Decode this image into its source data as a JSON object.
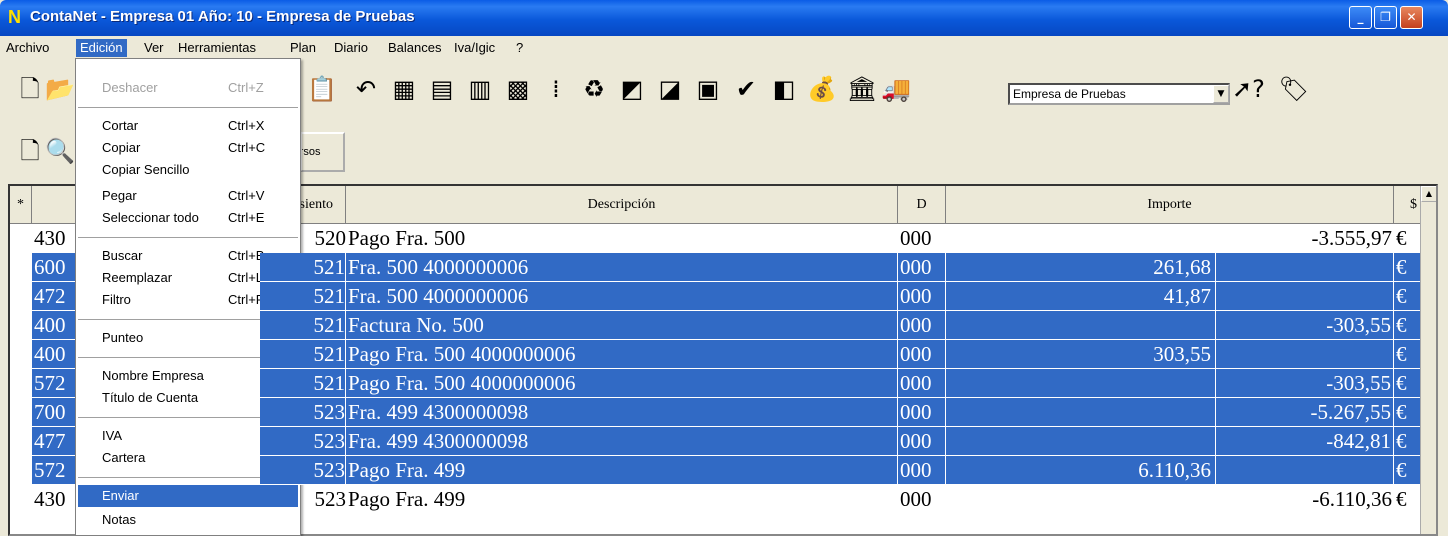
{
  "window": {
    "title": "ContaNet - Empresa 01  Año: 10 - Empresa de Pruebas"
  },
  "menubar": [
    "Archivo",
    "Edición",
    "Ver",
    "Herramientas",
    "Plan",
    "Diario",
    "Balances",
    "Iva/Igic",
    "?"
  ],
  "toolbar": {
    "company_value": "Empresa de Pruebas",
    "recursos_label": "Recursos"
  },
  "grid": {
    "headers": {
      "star": "*",
      "asiento": "Asiento",
      "descripcion": "Descripción",
      "d": "D",
      "importe": "Importe",
      "currency": "$"
    },
    "rows": [
      {
        "account": "430",
        "asiento": "520",
        "desc": "Pago Fra. 500",
        "d": "000",
        "debe": "",
        "haber": "-3.555,97",
        "cur": "€",
        "selected": false
      },
      {
        "account": "600",
        "asiento": "521",
        "desc": "Fra. 500 4000000006",
        "d": "000",
        "debe": "261,68",
        "haber": "",
        "cur": "€",
        "selected": true
      },
      {
        "account": "472",
        "asiento": "521",
        "desc": "Fra. 500 4000000006",
        "d": "000",
        "debe": "41,87",
        "haber": "",
        "cur": "€",
        "selected": true
      },
      {
        "account": "400",
        "asiento": "521",
        "desc": "Factura No.  500",
        "d": "000",
        "debe": "",
        "haber": "-303,55",
        "cur": "€",
        "selected": true
      },
      {
        "account": "400",
        "asiento": "521",
        "desc": "Pago Fra. 500 4000000006",
        "d": "000",
        "debe": "303,55",
        "haber": "",
        "cur": "€",
        "selected": true
      },
      {
        "account": "572",
        "asiento": "521",
        "desc": "Pago Fra. 500 4000000006",
        "d": "000",
        "debe": "",
        "haber": "-303,55",
        "cur": "€",
        "selected": true
      },
      {
        "account": "700",
        "asiento": "523",
        "desc": "Fra. 499 4300000098",
        "d": "000",
        "debe": "",
        "haber": "-5.267,55",
        "cur": "€",
        "selected": true
      },
      {
        "account": "477",
        "asiento": "523",
        "desc": "Fra. 499 4300000098",
        "d": "000",
        "debe": "",
        "haber": "-842,81",
        "cur": "€",
        "selected": true
      },
      {
        "account": "572",
        "asiento": "523",
        "desc": "Pago Fra. 499",
        "d": "000",
        "debe": "6.110,36",
        "haber": "",
        "cur": "€",
        "selected": true
      },
      {
        "account": "430",
        "asiento": "523",
        "desc": "Pago Fra. 499",
        "d": "000",
        "debe": "",
        "haber": "-6.110,36",
        "cur": "€",
        "selected": false
      }
    ]
  },
  "edit_menu": {
    "items": [
      {
        "label": "Deshacer",
        "shortcut": "Ctrl+Z",
        "disabled": true
      },
      {
        "label": "Cortar",
        "shortcut": "Ctrl+X"
      },
      {
        "label": "Copiar",
        "shortcut": "Ctrl+C"
      },
      {
        "label": "Copiar Sencillo",
        "shortcut": ""
      },
      {
        "label": "Pegar",
        "shortcut": "Ctrl+V"
      },
      {
        "label": "Seleccionar todo",
        "shortcut": "Ctrl+E"
      },
      {
        "label": "Buscar",
        "shortcut": "Ctrl+B"
      },
      {
        "label": "Reemplazar",
        "shortcut": "Ctrl+L"
      },
      {
        "label": "Filtro",
        "shortcut": "Ctrl+F"
      },
      {
        "label": "Punteo",
        "shortcut": ""
      },
      {
        "label": "Nombre Empresa",
        "shortcut": ""
      },
      {
        "label": "Título de Cuenta",
        "shortcut": ""
      },
      {
        "label": "IVA",
        "shortcut": ""
      },
      {
        "label": "Cartera",
        "shortcut": ""
      },
      {
        "label": "Enviar",
        "shortcut": "",
        "highlighted": true
      },
      {
        "label": "Notas",
        "shortcut": ""
      }
    ]
  },
  "colors": {
    "selection": "#316AC5",
    "titlebar": "#0A58DA",
    "face": "#ECE9D8"
  }
}
